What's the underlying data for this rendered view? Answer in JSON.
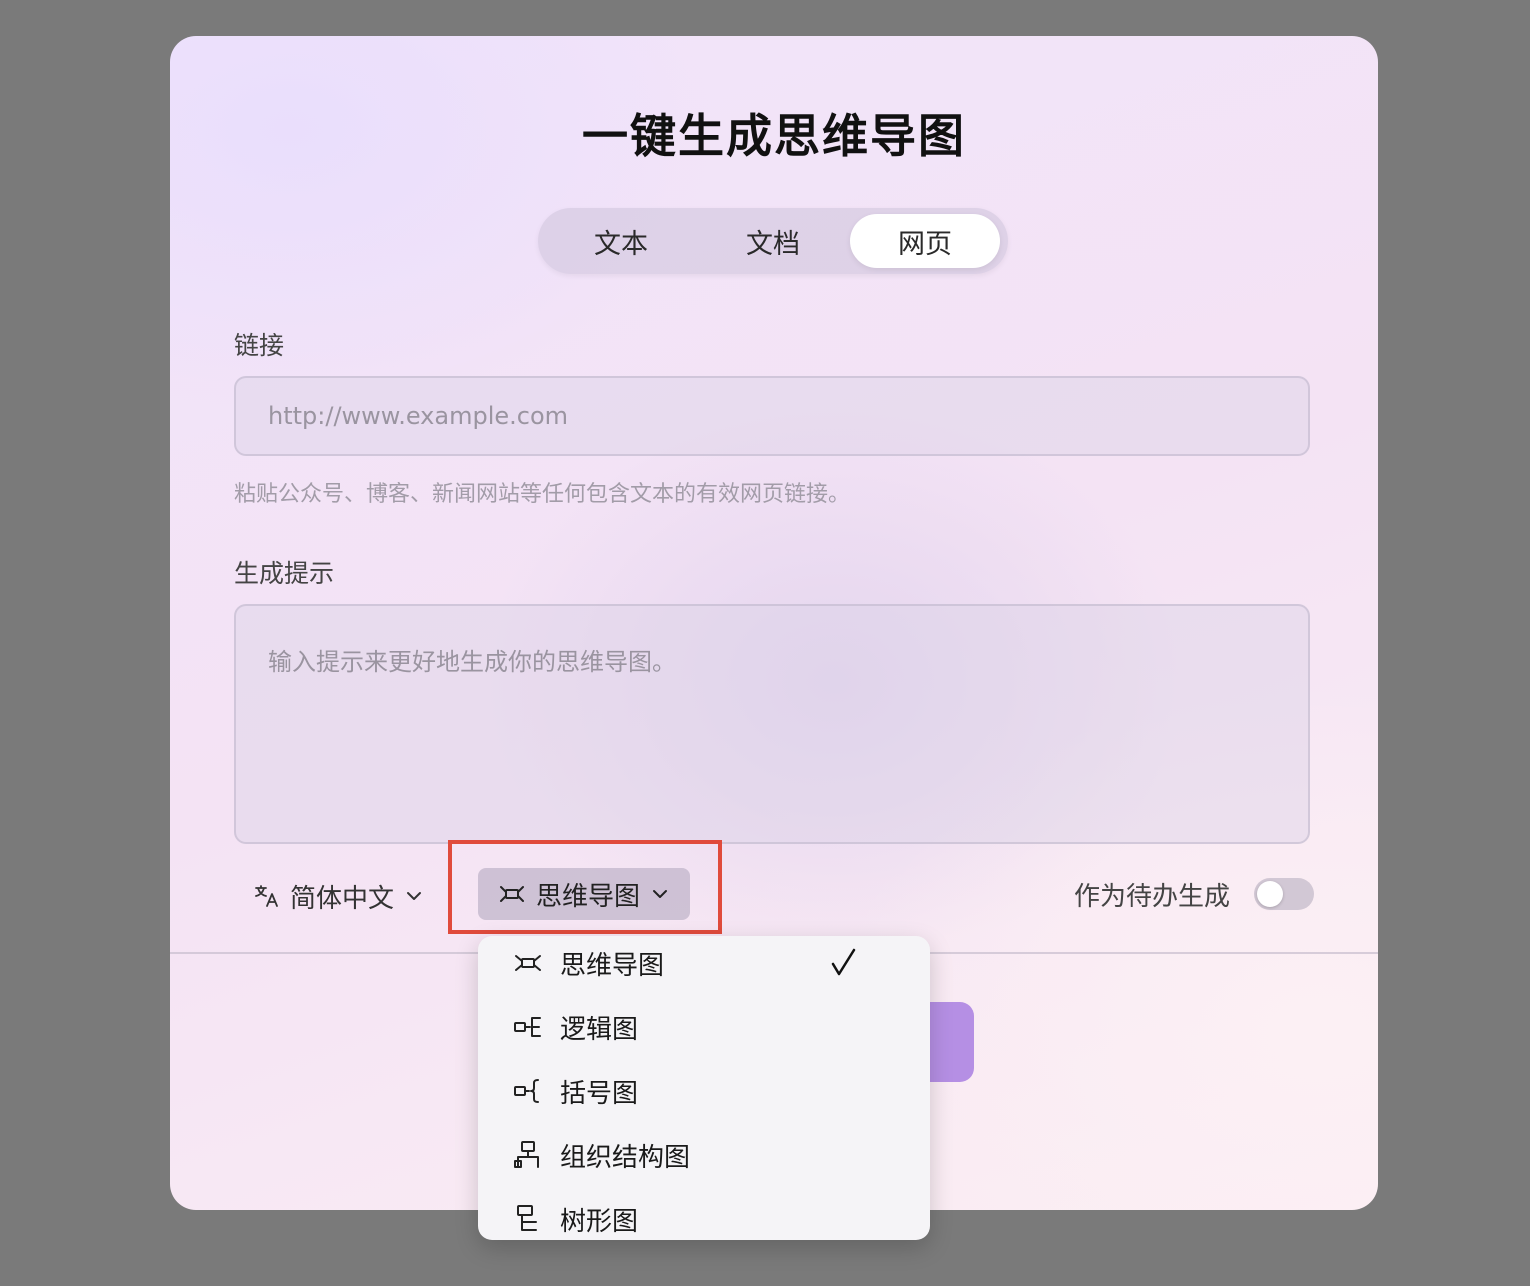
{
  "modal": {
    "title": "一键生成思维导图",
    "tabs": [
      {
        "label": "文本",
        "active": false
      },
      {
        "label": "文档",
        "active": false
      },
      {
        "label": "网页",
        "active": true
      }
    ],
    "link": {
      "label": "链接",
      "placeholder": "http://www.example.com",
      "hint": "粘贴公众号、博客、新闻网站等任何包含文本的有效网页链接。"
    },
    "prompt": {
      "label": "生成提示",
      "placeholder": "输入提示来更好地生成你的思维导图。"
    },
    "language": {
      "icon": "translate-icon",
      "value": "简体中文"
    },
    "type_select": {
      "icon": "mindmap-icon",
      "value": "思维导图"
    },
    "todo": {
      "label": "作为待办生成",
      "enabled": false
    },
    "accent_color": "#b58fe4",
    "highlight_color": "#e04b3c"
  },
  "dropdown": {
    "items": [
      {
        "label": "思维导图",
        "icon": "mindmap-icon",
        "selected": true
      },
      {
        "label": "逻辑图",
        "icon": "logic-chart-icon",
        "selected": false
      },
      {
        "label": "括号图",
        "icon": "brace-map-icon",
        "selected": false
      },
      {
        "label": "组织结构图",
        "icon": "org-chart-icon",
        "selected": false
      },
      {
        "label": "树形图",
        "icon": "tree-chart-icon",
        "selected": false
      }
    ]
  }
}
